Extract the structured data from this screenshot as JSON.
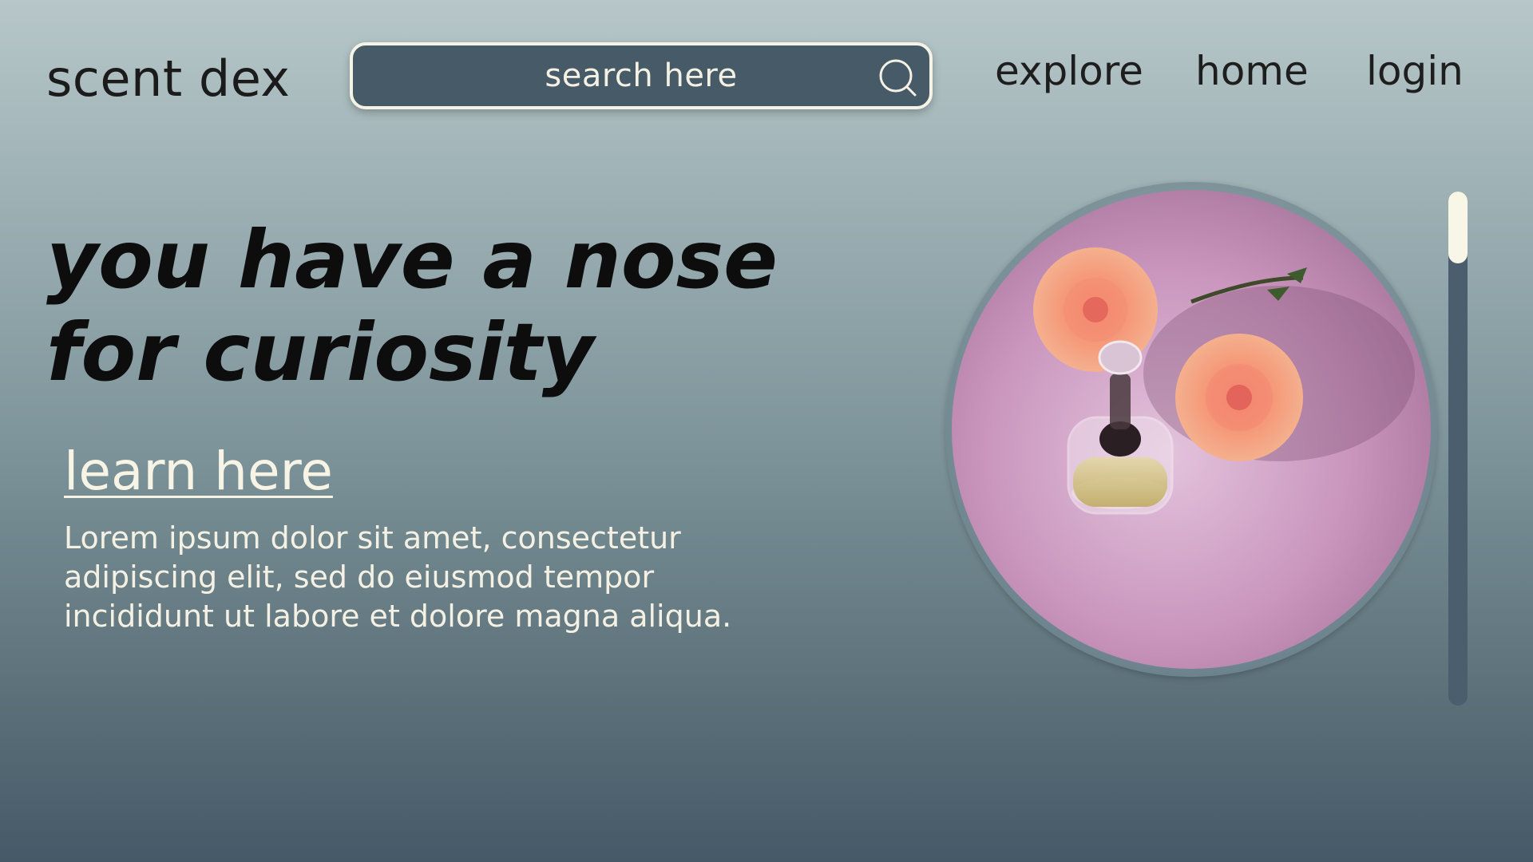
{
  "header": {
    "logo": "scent dex",
    "search_placeholder": "search here",
    "nav": {
      "explore": "explore",
      "home": "home",
      "login": "login"
    }
  },
  "hero": {
    "title": "you have a nose for curiosity",
    "link_label": "learn here",
    "body": "Lorem ipsum dolor sit amet, consectetur adipiscing elit, sed do eiusmod tempor incididunt ut labore et dolore magna aliqua."
  },
  "image": {
    "subject": "perfume bottle with peach roses on pink background"
  },
  "scrollbar": {
    "position_fraction": 0.0
  },
  "colors": {
    "search_bg": "#465a67",
    "accent_light": "#f4f1e4",
    "bg_top": "#b7c7c9",
    "bg_bottom": "#465968"
  },
  "icons": [
    "search-icon"
  ]
}
